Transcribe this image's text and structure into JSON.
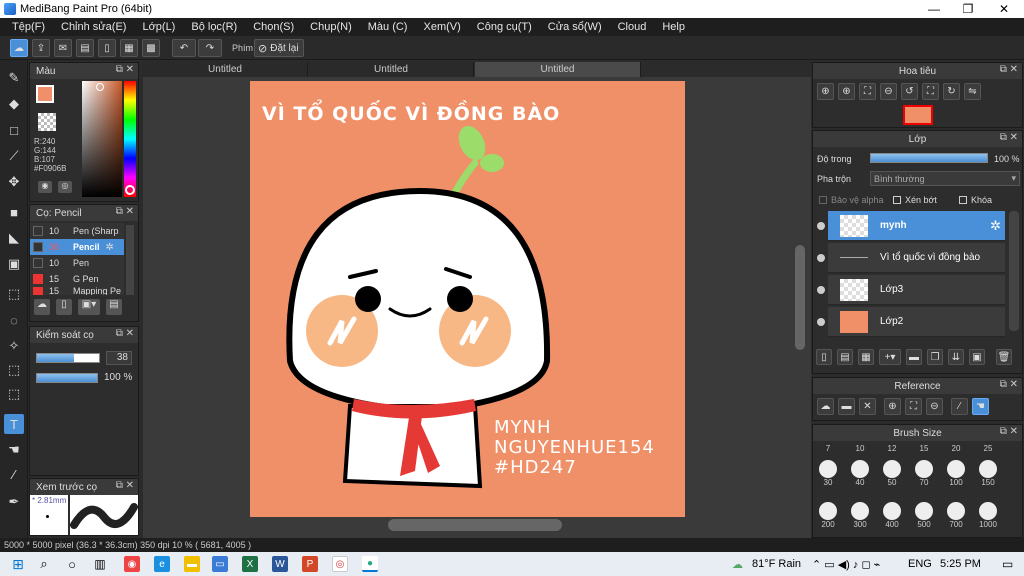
{
  "window": {
    "title": "MediBang Paint Pro (64bit)",
    "minimize": "—",
    "restore": "❐",
    "close": "✕"
  },
  "menu": [
    "Tệp(F)",
    "Chỉnh sửa(E)",
    "Lớp(L)",
    "Bộ lọc(R)",
    "Chọn(S)",
    "Chụp(N)",
    "Màu (C)",
    "Xem(V)",
    "Công cụ(T)",
    "Cửa sổ(W)",
    "Cloud",
    "Help"
  ],
  "toolbar": {
    "shortcut_label": "Phím",
    "reset_label": "Đặt lại"
  },
  "tabs": [
    "Untitled",
    "Untitled",
    "Untitled"
  ],
  "color_panel": {
    "title": "Màu",
    "r": "R:240",
    "g": "G:144",
    "b": "B:107",
    "hex": "#F0906B",
    "fg_color": "#F0906B"
  },
  "brush_panel": {
    "title": "Cọ: Pencil",
    "items": [
      {
        "size": "10",
        "name": "Pen (Sharp"
      },
      {
        "size": "30",
        "name": "Pencil"
      },
      {
        "size": "10",
        "name": "Pen"
      },
      {
        "size": "15",
        "name": "G Pen"
      },
      {
        "size": "15",
        "name": "Mapping Pe"
      }
    ]
  },
  "brush_control": {
    "title": "Kiểm soát cọ",
    "size": "38",
    "opacity": "100 %",
    "size_level": 0.6,
    "opacity_level": 1.0
  },
  "brush_preview": {
    "title": "Xem trước cọ",
    "size": "* 2.81mm"
  },
  "navigator": {
    "title": "Hoa tiêu"
  },
  "layer_panel": {
    "title": "Lớp",
    "opacity_label": "Độ trong",
    "opacity_value": "100 %",
    "opacity_level": 1.0,
    "blend_label": "Pha trộn",
    "blend_value": "Bình thường",
    "protect_alpha": "Bảo vệ alpha",
    "clipping": "Xén bớt",
    "lock": "Khóa",
    "layers": [
      {
        "name": "mynh"
      },
      {
        "name": "Vì tổ quốc vì đồng bào"
      },
      {
        "name": "Lớp3"
      },
      {
        "name": "Lớp2"
      }
    ]
  },
  "reference": {
    "title": "Reference"
  },
  "brush_size": {
    "title": "Brush Size",
    "top_labels": [
      "7",
      "10",
      "12",
      "15",
      "20",
      "25"
    ],
    "row1": [
      "30",
      "40",
      "50",
      "70",
      "100",
      "150"
    ],
    "row2": [
      "200",
      "300",
      "400",
      "500",
      "700",
      "1000"
    ]
  },
  "artwork": {
    "headline": "VÌ TỔ QUỐC VÌ ĐỒNG BÀO",
    "line1": "MYNH",
    "line2": "NGUYENHUE154",
    "line3": "#HD247",
    "bg_color": "#F09068"
  },
  "status": {
    "text": "5000 * 5000 pixel  (36.3 * 36.3cm)   350 dpi   10 %   ( 5681, 4005 )"
  },
  "taskbar": {
    "weather": "81°F  Rain",
    "lang": "ENG",
    "time": "5:25 PM"
  }
}
